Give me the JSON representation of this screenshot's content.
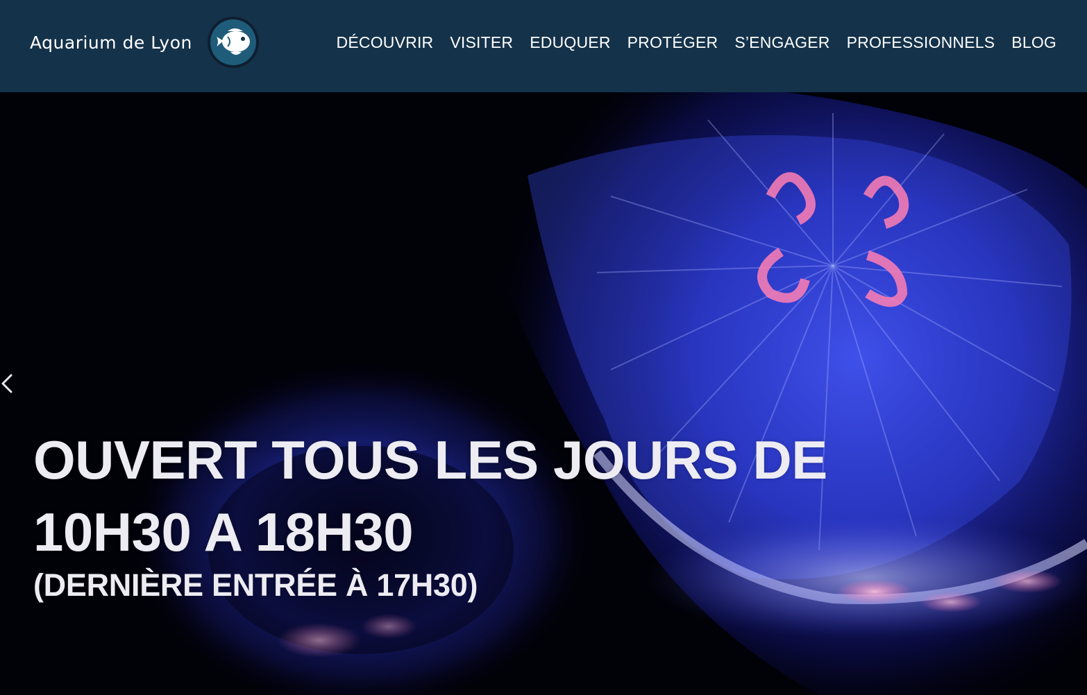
{
  "header": {
    "brand_name": "Aquarium de Lyon",
    "logo_icon": "fish-logo-icon"
  },
  "nav": {
    "items": [
      {
        "label": "DÉCOUVRIR"
      },
      {
        "label": "VISITER"
      },
      {
        "label": "EDUQUER"
      },
      {
        "label": "PROTÉGER"
      },
      {
        "label": "S’ENGAGER"
      },
      {
        "label": "PROFESSIONNELS"
      },
      {
        "label": "BLOG"
      }
    ]
  },
  "hero": {
    "title_line1": "OUVERT TOUS LES JOURS DE",
    "title_line2": "10H30 A 18H30",
    "subtitle": "(DERNIÈRE ENTRÉE À 17H30)",
    "background": "jellyfish-photo",
    "prev_icon": "chevron-left-icon"
  },
  "colors": {
    "header_bg": "#14324a",
    "logo_circle": "#1f5c7a",
    "hero_bg": "#010108",
    "text": "#ececf2"
  }
}
